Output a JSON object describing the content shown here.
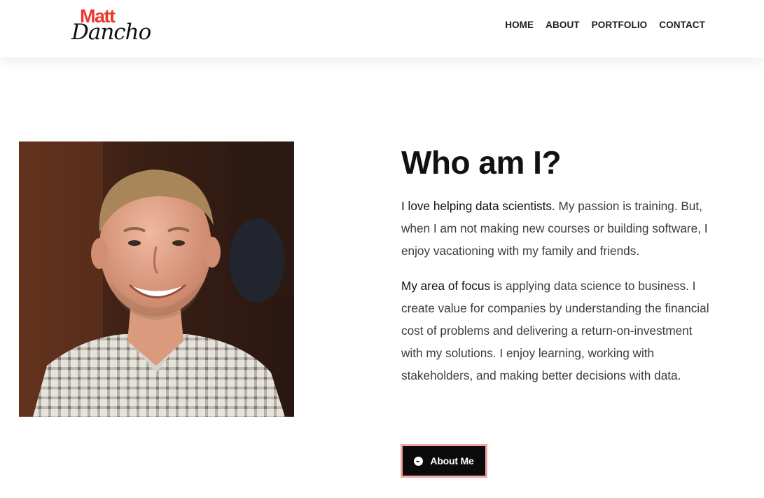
{
  "header": {
    "logo": {
      "top_text": "Matt",
      "bottom_text": "Dancho",
      "accent_color": "#e8382f"
    },
    "nav": [
      {
        "label": "HOME"
      },
      {
        "label": "ABOUT"
      },
      {
        "label": "PORTFOLIO"
      },
      {
        "label": "CONTACT"
      }
    ]
  },
  "main": {
    "photo": {
      "icon": "portrait-photo"
    },
    "heading": "Who am I?",
    "paragraph1": {
      "bold": "I love helping data scientists.",
      "text": " My passion is training. But, when I am not making new courses or building software, I enjoy vacationing with my family and friends."
    },
    "paragraph2": {
      "bold": "My area of focus",
      "text": " is applying data science to business. I create value for companies by understanding the financial cost of problems and delivering a return-on-investment with my solutions. I enjoy learning, working with stakeholders, and making better decisions with data."
    },
    "button": {
      "label": "About Me",
      "icon": "smile-icon",
      "border_color": "#f1a5a0",
      "background": "#0b0b0b"
    }
  }
}
